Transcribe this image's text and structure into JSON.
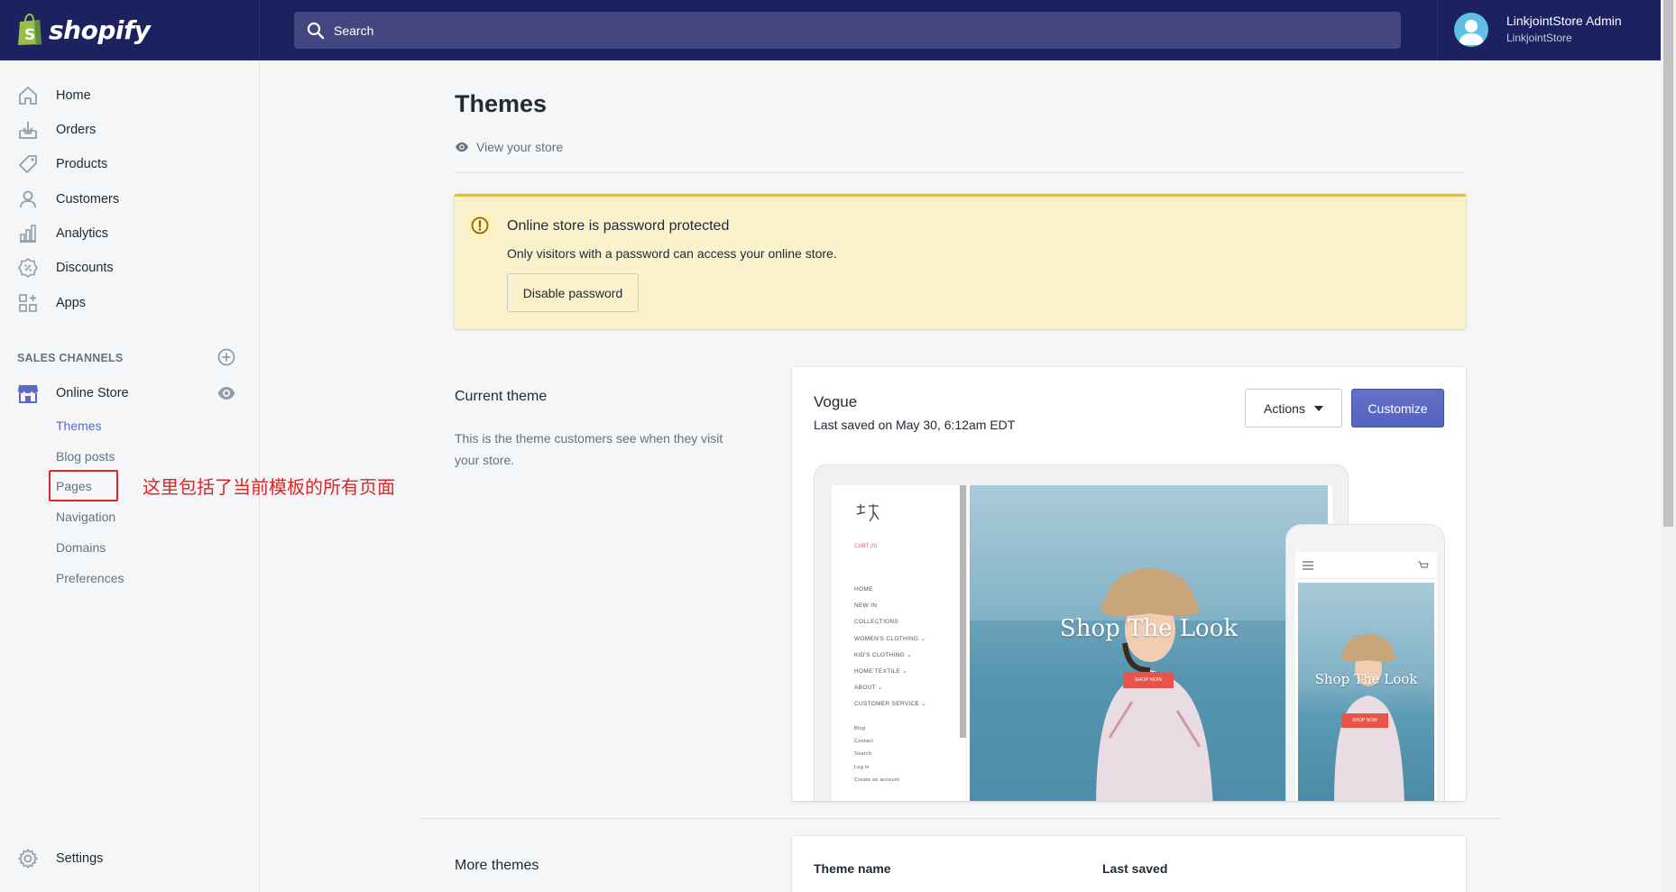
{
  "topbar": {
    "brand": "shopify",
    "search_placeholder": "Search",
    "user_name": "LinkjointStore Admin",
    "user_store": "LinkjointStore"
  },
  "sidebar": {
    "items": [
      {
        "label": "Home",
        "icon": "home-icon"
      },
      {
        "label": "Orders",
        "icon": "orders-icon"
      },
      {
        "label": "Products",
        "icon": "tag-icon"
      },
      {
        "label": "Customers",
        "icon": "person-icon"
      },
      {
        "label": "Analytics",
        "icon": "bar-chart-icon"
      },
      {
        "label": "Discounts",
        "icon": "discount-icon"
      },
      {
        "label": "Apps",
        "icon": "apps-icon"
      }
    ],
    "sales_channels_heading": "SALES CHANNELS",
    "online_store": "Online Store",
    "sub_items": [
      "Themes",
      "Blog posts",
      "Pages",
      "Navigation",
      "Domains",
      "Preferences"
    ],
    "active_sub_item": "Themes",
    "settings": "Settings",
    "annotation": "这里包括了当前模板的所有页面"
  },
  "main": {
    "title": "Themes",
    "view_store": "View your store",
    "banner": {
      "title": "Online store is password protected",
      "text": "Only visitors with a password can access your online store.",
      "button": "Disable password"
    },
    "current_theme": {
      "label": "Current theme",
      "description": "This is the theme customers see when they visit your store.",
      "name": "Vogue",
      "last_saved": "Last saved on May 30, 6:12am EDT",
      "actions_label": "Actions",
      "customize_label": "Customize"
    },
    "preview": {
      "hero_title": "Shop The Look",
      "hero_button": "SHOP NOW",
      "cart": "CART (0)",
      "menu": [
        "HOME",
        "NEW IN",
        "COLLECTIONS",
        "WOMEN'S CLOTHING ⌄",
        "KID'S CLOTHING ⌄",
        "HOME TEXTILE ⌄",
        "ABOUT ⌄",
        "CUSTOMER SERVICE ⌄"
      ],
      "footer_links": [
        "Blog",
        "Contact",
        "Search",
        "Log in",
        "Create an account"
      ]
    },
    "more_themes": {
      "label": "More themes",
      "col_name": "Theme name",
      "col_saved": "Last saved"
    }
  },
  "colors": {
    "topbar": "#1c2260",
    "accent": "#5c6ac4",
    "banner_bg": "#fcf1cd",
    "banner_border": "#eec200",
    "annotation": "#e02424"
  }
}
